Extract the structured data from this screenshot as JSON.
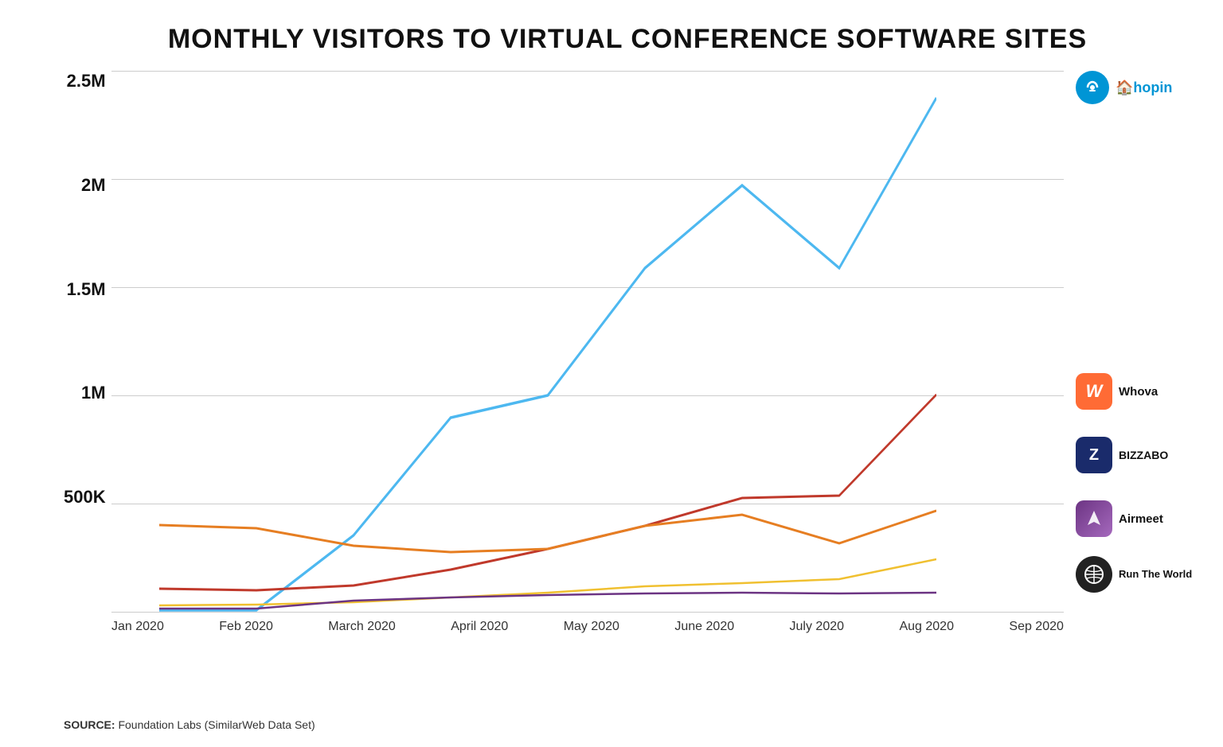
{
  "title": "MONTHLY VISITORS TO VIRTUAL CONFERENCE SOFTWARE SITES",
  "source": "Foundation Labs (SimilarWeb Data Set)",
  "yAxis": {
    "labels": [
      "2.5M",
      "2M",
      "1.5M",
      "1M",
      "500K",
      ""
    ]
  },
  "xAxis": {
    "labels": [
      "Jan 2020",
      "Feb 2020",
      "March 2020",
      "April 2020",
      "May 2020",
      "June 2020",
      "July 2020",
      "Aug 2020",
      "Sep 2020"
    ]
  },
  "gridLines": [
    0,
    1,
    2,
    3,
    4
  ],
  "series": {
    "hopin": {
      "name": "hopin",
      "color": "#4db8f0",
      "values": [
        5,
        5,
        230,
        610,
        800,
        1650,
        2100,
        1600,
        2420
      ]
    },
    "whova": {
      "name": "Whova",
      "color": "#c0392b",
      "values": [
        120,
        115,
        135,
        200,
        280,
        400,
        540,
        560,
        1010
      ]
    },
    "bizzabo": {
      "name": "BIZZABO",
      "color": "#e67e22",
      "values": [
        340,
        320,
        240,
        210,
        230,
        390,
        430,
        290,
        420
      ]
    },
    "airmeet": {
      "name": "Airmeet",
      "color": "#f0c030",
      "values": [
        20,
        25,
        45,
        80,
        100,
        130,
        150,
        170,
        260
      ]
    },
    "runtheworld": {
      "name": "Run The World",
      "color": "#6c3483",
      "values": [
        10,
        10,
        55,
        80,
        85,
        90,
        90,
        85,
        90
      ]
    }
  },
  "legend": [
    {
      "name": "hopin",
      "bgColor": "#0095d5",
      "textColor": "#fff",
      "symbol": "hopin"
    },
    {
      "name": "Whova",
      "bgColor": "#ff6b35",
      "textColor": "#fff",
      "symbol": "W"
    },
    {
      "name": "BIZZABO",
      "bgColor": "#1a2b6b",
      "textColor": "#fff",
      "symbol": "Z"
    },
    {
      "name": "Airmeet",
      "bgColor": "#6c3483",
      "textColor": "#fff",
      "symbol": "A"
    },
    {
      "name": "Run The World",
      "bgColor": "#222",
      "textColor": "#fff",
      "symbol": "X"
    }
  ],
  "chartDimensions": {
    "maxValue": 2500,
    "minValue": 0,
    "points": 9
  }
}
